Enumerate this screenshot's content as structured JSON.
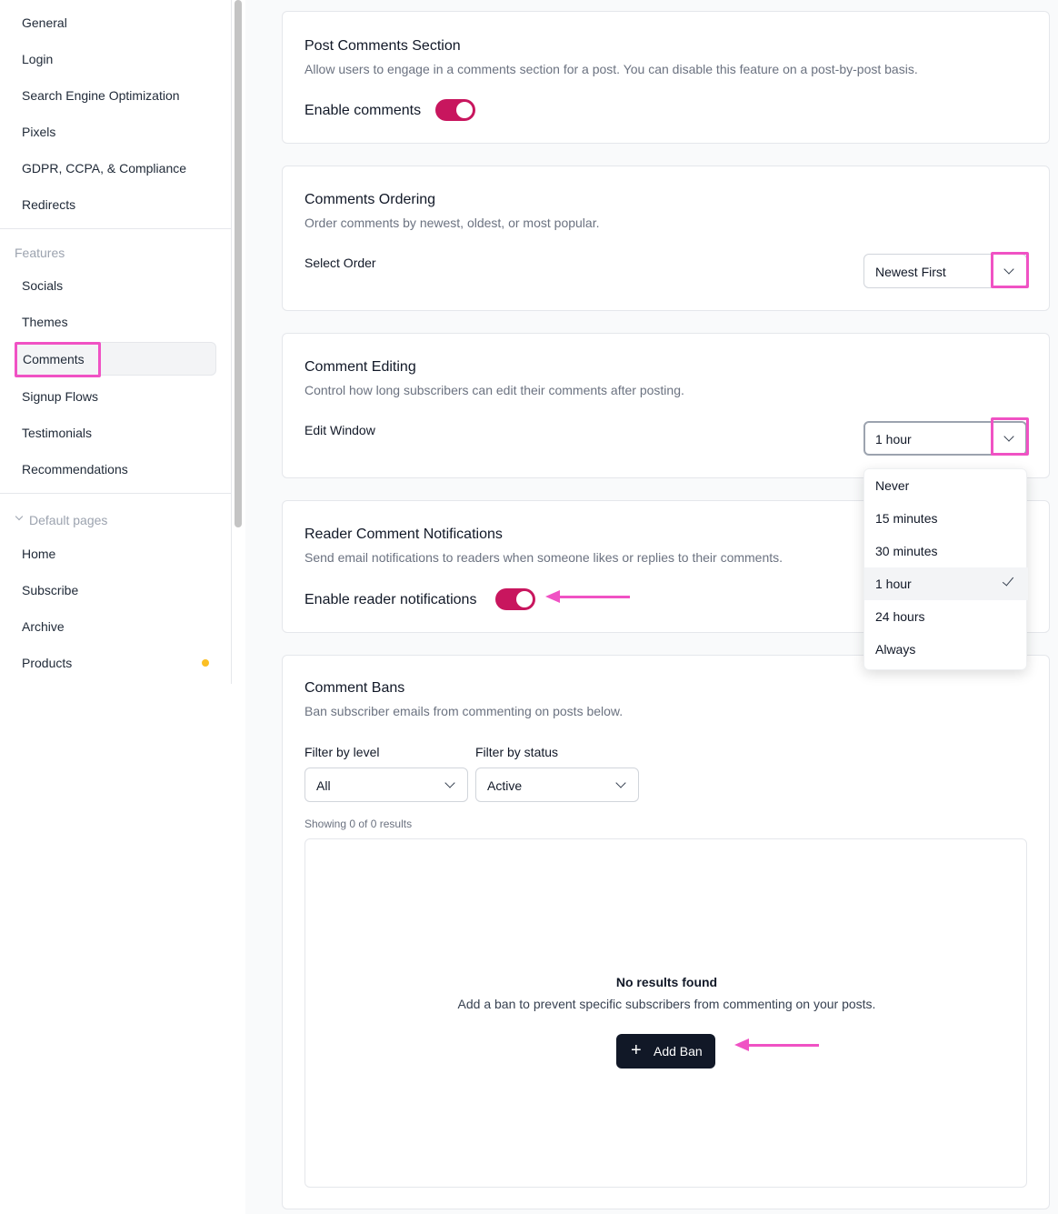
{
  "sidebar": {
    "settings_items": [
      "General",
      "Login",
      "Search Engine Optimization",
      "Pixels",
      "GDPR, CCPA, & Compliance",
      "Redirects"
    ],
    "features_heading": "Features",
    "features_items": [
      "Socials",
      "Themes",
      "Comments",
      "Signup Flows",
      "Testimonials",
      "Recommendations"
    ],
    "default_pages_heading": "Default pages",
    "default_pages_items": [
      "Home",
      "Subscribe",
      "Archive",
      "Products"
    ]
  },
  "post_comments": {
    "title": "Post Comments Section",
    "description": "Allow users to engage in a comments section for a post. You can disable this feature on a post-by-post basis.",
    "toggle_label": "Enable comments",
    "enabled": true
  },
  "ordering": {
    "title": "Comments Ordering",
    "description": "Order comments by newest, oldest, or most popular.",
    "label": "Select Order",
    "value": "Newest First"
  },
  "editing": {
    "title": "Comment Editing",
    "description": "Control how long subscribers can edit their comments after posting.",
    "label": "Edit Window",
    "value": "1 hour",
    "options": [
      "Never",
      "15 minutes",
      "30 minutes",
      "1 hour",
      "24 hours",
      "Always"
    ]
  },
  "notifications": {
    "title": "Reader Comment Notifications",
    "description": "Send email notifications to readers when someone likes or replies to their comments.",
    "toggle_label": "Enable reader notifications",
    "enabled": true
  },
  "bans": {
    "title": "Comment Bans",
    "description": "Ban subscriber emails from commenting on posts below.",
    "filter_level_label": "Filter by level",
    "filter_level_value": "All",
    "filter_status_label": "Filter by status",
    "filter_status_value": "Active",
    "showing": "Showing 0 of 0 results",
    "empty_title": "No results found",
    "empty_desc": "Add a ban to prevent specific subscribers from commenting on your posts.",
    "add_label": "Add Ban"
  },
  "colors": {
    "toggle_on": "#c8165e",
    "highlight": "#f052c4",
    "dot": "#fbbf24",
    "primary_button": "#111827"
  }
}
